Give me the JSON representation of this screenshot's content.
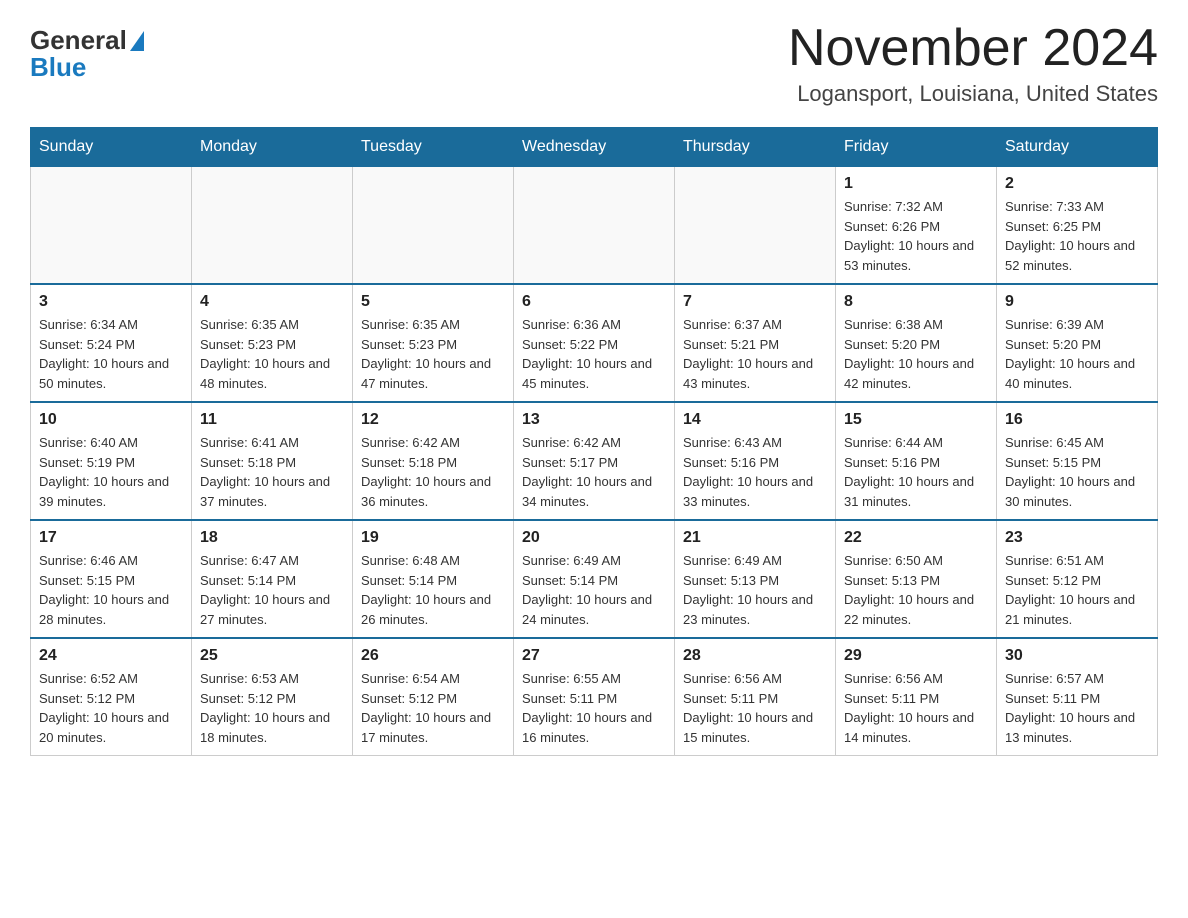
{
  "header": {
    "logo_general": "General",
    "logo_blue": "Blue",
    "month_title": "November 2024",
    "location": "Logansport, Louisiana, United States"
  },
  "calendar": {
    "days_of_week": [
      "Sunday",
      "Monday",
      "Tuesday",
      "Wednesday",
      "Thursday",
      "Friday",
      "Saturday"
    ],
    "weeks": [
      [
        {
          "day": "",
          "info": ""
        },
        {
          "day": "",
          "info": ""
        },
        {
          "day": "",
          "info": ""
        },
        {
          "day": "",
          "info": ""
        },
        {
          "day": "",
          "info": ""
        },
        {
          "day": "1",
          "info": "Sunrise: 7:32 AM\nSunset: 6:26 PM\nDaylight: 10 hours and 53 minutes."
        },
        {
          "day": "2",
          "info": "Sunrise: 7:33 AM\nSunset: 6:25 PM\nDaylight: 10 hours and 52 minutes."
        }
      ],
      [
        {
          "day": "3",
          "info": "Sunrise: 6:34 AM\nSunset: 5:24 PM\nDaylight: 10 hours and 50 minutes."
        },
        {
          "day": "4",
          "info": "Sunrise: 6:35 AM\nSunset: 5:23 PM\nDaylight: 10 hours and 48 minutes."
        },
        {
          "day": "5",
          "info": "Sunrise: 6:35 AM\nSunset: 5:23 PM\nDaylight: 10 hours and 47 minutes."
        },
        {
          "day": "6",
          "info": "Sunrise: 6:36 AM\nSunset: 5:22 PM\nDaylight: 10 hours and 45 minutes."
        },
        {
          "day": "7",
          "info": "Sunrise: 6:37 AM\nSunset: 5:21 PM\nDaylight: 10 hours and 43 minutes."
        },
        {
          "day": "8",
          "info": "Sunrise: 6:38 AM\nSunset: 5:20 PM\nDaylight: 10 hours and 42 minutes."
        },
        {
          "day": "9",
          "info": "Sunrise: 6:39 AM\nSunset: 5:20 PM\nDaylight: 10 hours and 40 minutes."
        }
      ],
      [
        {
          "day": "10",
          "info": "Sunrise: 6:40 AM\nSunset: 5:19 PM\nDaylight: 10 hours and 39 minutes."
        },
        {
          "day": "11",
          "info": "Sunrise: 6:41 AM\nSunset: 5:18 PM\nDaylight: 10 hours and 37 minutes."
        },
        {
          "day": "12",
          "info": "Sunrise: 6:42 AM\nSunset: 5:18 PM\nDaylight: 10 hours and 36 minutes."
        },
        {
          "day": "13",
          "info": "Sunrise: 6:42 AM\nSunset: 5:17 PM\nDaylight: 10 hours and 34 minutes."
        },
        {
          "day": "14",
          "info": "Sunrise: 6:43 AM\nSunset: 5:16 PM\nDaylight: 10 hours and 33 minutes."
        },
        {
          "day": "15",
          "info": "Sunrise: 6:44 AM\nSunset: 5:16 PM\nDaylight: 10 hours and 31 minutes."
        },
        {
          "day": "16",
          "info": "Sunrise: 6:45 AM\nSunset: 5:15 PM\nDaylight: 10 hours and 30 minutes."
        }
      ],
      [
        {
          "day": "17",
          "info": "Sunrise: 6:46 AM\nSunset: 5:15 PM\nDaylight: 10 hours and 28 minutes."
        },
        {
          "day": "18",
          "info": "Sunrise: 6:47 AM\nSunset: 5:14 PM\nDaylight: 10 hours and 27 minutes."
        },
        {
          "day": "19",
          "info": "Sunrise: 6:48 AM\nSunset: 5:14 PM\nDaylight: 10 hours and 26 minutes."
        },
        {
          "day": "20",
          "info": "Sunrise: 6:49 AM\nSunset: 5:14 PM\nDaylight: 10 hours and 24 minutes."
        },
        {
          "day": "21",
          "info": "Sunrise: 6:49 AM\nSunset: 5:13 PM\nDaylight: 10 hours and 23 minutes."
        },
        {
          "day": "22",
          "info": "Sunrise: 6:50 AM\nSunset: 5:13 PM\nDaylight: 10 hours and 22 minutes."
        },
        {
          "day": "23",
          "info": "Sunrise: 6:51 AM\nSunset: 5:12 PM\nDaylight: 10 hours and 21 minutes."
        }
      ],
      [
        {
          "day": "24",
          "info": "Sunrise: 6:52 AM\nSunset: 5:12 PM\nDaylight: 10 hours and 20 minutes."
        },
        {
          "day": "25",
          "info": "Sunrise: 6:53 AM\nSunset: 5:12 PM\nDaylight: 10 hours and 18 minutes."
        },
        {
          "day": "26",
          "info": "Sunrise: 6:54 AM\nSunset: 5:12 PM\nDaylight: 10 hours and 17 minutes."
        },
        {
          "day": "27",
          "info": "Sunrise: 6:55 AM\nSunset: 5:11 PM\nDaylight: 10 hours and 16 minutes."
        },
        {
          "day": "28",
          "info": "Sunrise: 6:56 AM\nSunset: 5:11 PM\nDaylight: 10 hours and 15 minutes."
        },
        {
          "day": "29",
          "info": "Sunrise: 6:56 AM\nSunset: 5:11 PM\nDaylight: 10 hours and 14 minutes."
        },
        {
          "day": "30",
          "info": "Sunrise: 6:57 AM\nSunset: 5:11 PM\nDaylight: 10 hours and 13 minutes."
        }
      ]
    ]
  }
}
